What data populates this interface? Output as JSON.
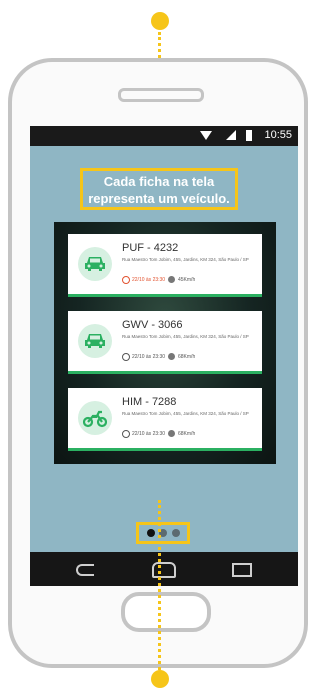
{
  "status_bar": {
    "time": "10:55"
  },
  "callout": {
    "line1": "Cada ficha na tela",
    "line2": "representa um veículo."
  },
  "vehicles": [
    {
      "plate": "PUF - 4232",
      "address": "Rua Maestro Tom Jobim, 455, Jardins, KM 324, São Paulo / SP",
      "time": "22/10 às 23:30",
      "speed": "45Km/h",
      "icon": "car-icon",
      "time_color": "#e2522f"
    },
    {
      "plate": "GWV - 3066",
      "address": "Rua Maestro Tom Jobim, 455, Jardins, KM 324, São Paulo / SP",
      "time": "22/10 às 23:30",
      "speed": "68Km/h",
      "icon": "car-icon",
      "time_color": "#555555"
    },
    {
      "plate": "HIM - 7288",
      "address": "Rua Maestro Tom Jobim, 455, Jardins, KM 324, São Paulo / SP",
      "time": "22/10 às 23:30",
      "speed": "68Km/h",
      "icon": "motorcycle-icon",
      "time_color": "#555555"
    }
  ],
  "pager": {
    "count": 3,
    "active": 1
  },
  "colors": {
    "accent": "#f6c519",
    "screen_bg": "#8fb6c4",
    "card_border": "#2bb061",
    "icon_bg": "#d6f0e1",
    "icon_fg": "#2bb061"
  }
}
